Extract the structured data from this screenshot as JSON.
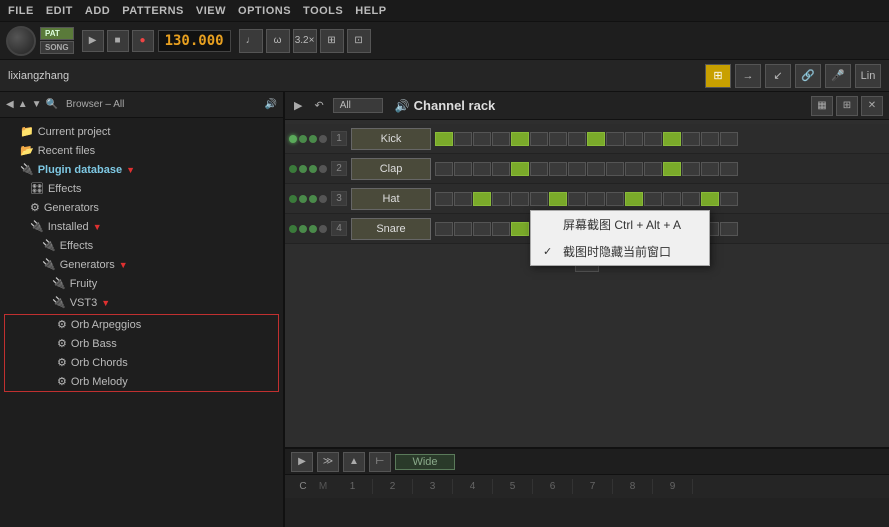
{
  "menubar": {
    "items": [
      "FILE",
      "EDIT",
      "ADD",
      "PATTERNS",
      "VIEW",
      "OPTIONS",
      "TOOLS",
      "HELP"
    ]
  },
  "transport": {
    "pat_label": "PAT",
    "song_label": "SONG",
    "play_icon": "▶",
    "stop_icon": "■",
    "record_icon": "●",
    "bpm": "130.000",
    "bpm_suffix": ""
  },
  "toolbar2": {
    "user": "lixiangzhang",
    "buttons": [
      "≡",
      "→",
      "↙",
      "🔗",
      "🎤",
      "Lin"
    ]
  },
  "browser": {
    "title": "Browser – All",
    "items": [
      {
        "label": "Current project",
        "indent": 1,
        "icon": "folder"
      },
      {
        "label": "Recent files",
        "indent": 1,
        "icon": "recent"
      },
      {
        "label": "Plugin database",
        "indent": 1,
        "icon": "plugin",
        "arrow": true
      },
      {
        "label": "Effects",
        "indent": 2,
        "icon": "fx"
      },
      {
        "label": "Generators",
        "indent": 2,
        "icon": "gen"
      },
      {
        "label": "Installed",
        "indent": 2,
        "icon": "installed",
        "arrow": true
      },
      {
        "label": "Effects",
        "indent": 3,
        "icon": "fx"
      },
      {
        "label": "Generators",
        "indent": 3,
        "icon": "gen",
        "arrow": true
      },
      {
        "label": "Fruity",
        "indent": 4,
        "icon": "fruity"
      },
      {
        "label": "VST3",
        "indent": 4,
        "icon": "vst3",
        "arrow": true
      },
      {
        "label": "Orb Arpeggios",
        "indent": 5,
        "icon": "gear"
      },
      {
        "label": "Orb Bass",
        "indent": 5,
        "icon": "gear"
      },
      {
        "label": "Orb Chords",
        "indent": 5,
        "icon": "gear"
      },
      {
        "label": "Orb Melody",
        "indent": 5,
        "icon": "gear"
      }
    ]
  },
  "channel_rack": {
    "title": "Channel rack",
    "filter": "All",
    "channels": [
      {
        "num": "1",
        "name": "Kick",
        "light": true
      },
      {
        "num": "2",
        "name": "Clap",
        "light": false
      },
      {
        "num": "3",
        "name": "Hat",
        "light": false
      },
      {
        "num": "4",
        "name": "Snare",
        "light": false
      }
    ],
    "add_btn": "+"
  },
  "context_menu": {
    "item1": "屏幕截图 Ctrl + Alt + A",
    "item2": "截图时隐藏当前窗口",
    "checked": true
  },
  "bottom_bar": {
    "wide_label": "Wide",
    "notes": [
      "C",
      "M",
      "1",
      "2",
      "3",
      "4",
      "5",
      "6",
      "7",
      "8",
      "9"
    ]
  }
}
